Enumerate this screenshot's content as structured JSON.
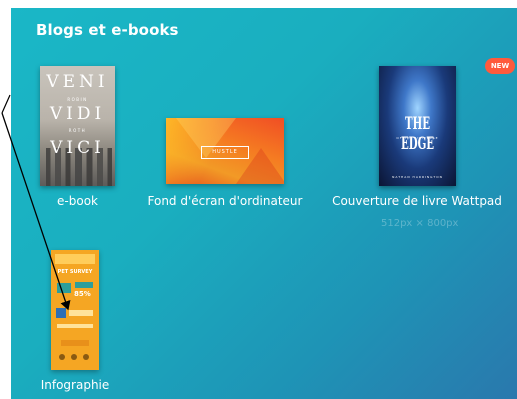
{
  "section": {
    "title": "Blogs et e-books"
  },
  "templates": [
    {
      "label": "e-book",
      "cover": {
        "words": [
          "VENI",
          "VIDI",
          "VICI"
        ],
        "sub_top": "ROBIN",
        "sub_mid": "ROTH"
      }
    },
    {
      "label": "Fond d'écran d'ordinateur",
      "cover": {
        "badge": "HUSTLE"
      }
    },
    {
      "label": "Couverture de livre Wattpad",
      "badge": "NEW",
      "dims": "512px × 800px",
      "cover": {
        "title": "THE EDGE",
        "subtitle": "OF THE UNIVERSE",
        "author": "NATHAN HARRINGTON"
      }
    },
    {
      "label": "Infographie",
      "cover": {
        "heading": "PET SURVEY",
        "percent": "85%"
      }
    }
  ],
  "colors": {
    "panel_start": "#1ab7c7",
    "panel_end": "#2a78ad",
    "new_badge": "#ff5a3c",
    "infographic": "#f5a623",
    "annotation_arrow": "#000000"
  },
  "icons": {
    "annotation": "arrow-annotation-icon"
  }
}
